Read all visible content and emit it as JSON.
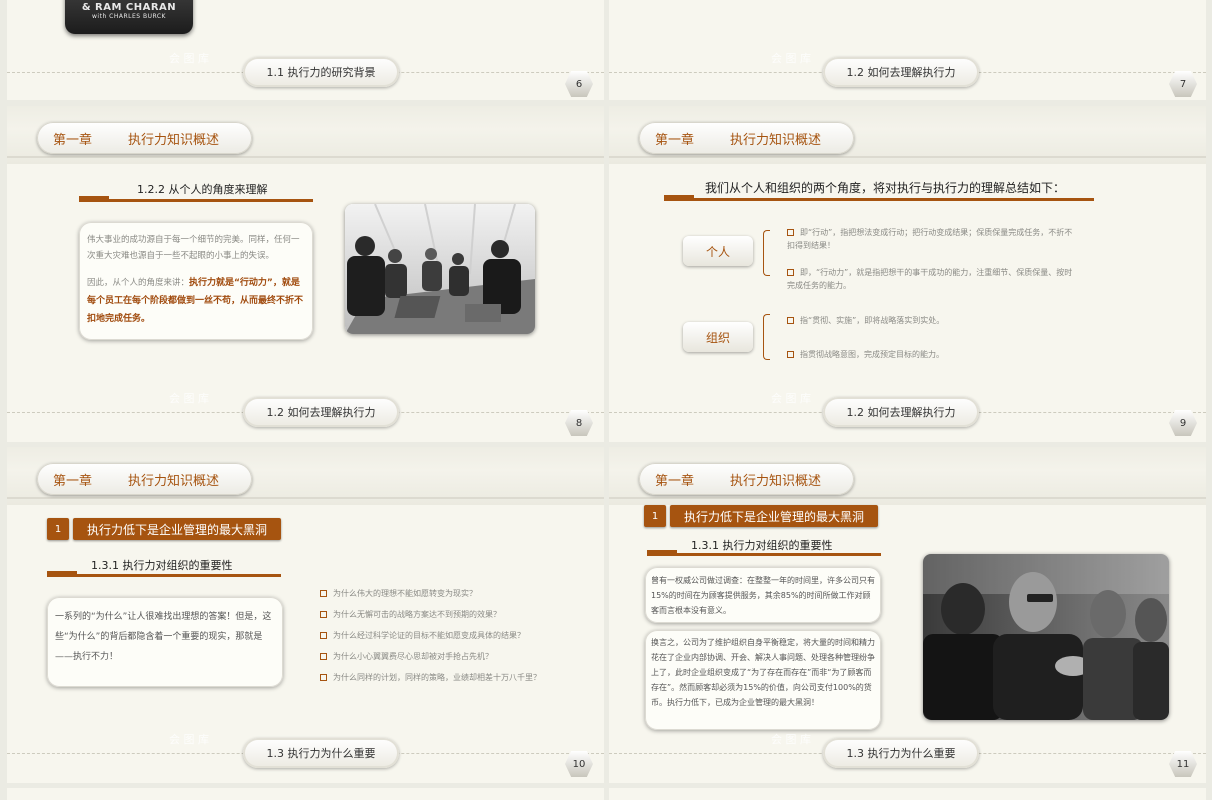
{
  "chapter": {
    "label": "第一章",
    "title": "执行力知识概述"
  },
  "watermark": "会 图 库",
  "slides": [
    {
      "footer": "1.1 执行力的研究背景",
      "page": "6",
      "book": {
        "line1": "& RAM CHARAN",
        "line2": "with CHARLES BURCK"
      }
    },
    {
      "footer": "1.2 如何去理解执行力",
      "page": "7"
    },
    {
      "footer": "1.2 如何去理解执行力",
      "page": "8",
      "heading": "1.2.2 从个人的角度来理解",
      "para1": "伟大事业的成功源自于每一个细节的完美。同样，任何一次重大灾难也源自于一些不起眼的小事上的失误。",
      "para2_prefix": "因此，从个人的角度来讲：",
      "para2_strong": "执行力就是“行动力”，就是每个员工在每个阶段都做到一丝不苟，从而最终不折不扣地完成任务。"
    },
    {
      "footer": "1.2 如何去理解执行力",
      "page": "9",
      "heading": "我们从个人和组织的两个角度，将对执行与执行力的理解总结如下：",
      "personal": {
        "label": "个人",
        "items": [
          "即“行动”，指把想法变成行动；把行动变成结果；保质保量完成任务，不折不扣得到结果！",
          "即，“行动力”，就是指把想干的事干成功的能力，注重细节、保质保量、按时完成任务的能力。"
        ]
      },
      "organization": {
        "label": "组织",
        "items": [
          "指“贯彻、实施”，即将战略落实到实处。",
          "指贯彻战略意图，完成预定目标的能力。"
        ]
      }
    },
    {
      "footer": "1.3 执行力为什么重要",
      "page": "10",
      "num": "1",
      "title": "执行力低下是企业管理的最大黑洞",
      "heading": "1.3.1 执行力对组织的重要性",
      "card": "一系列的“为什么”让人很难找出理想的答案！但是，这些“为什么”的背后都隐含着一个重要的现实，那就是——执行不力！",
      "questions": [
        "为什么伟大的理想不能如愿转变为现实？",
        "为什么无懈可击的战略方案达不到预期的效果？",
        "为什么经过科学论证的目标不能如愿变成具体的结果？",
        "为什么小心翼翼费尽心思却被对手抢占先机？",
        "为什么同样的计划，同样的策略，业绩却相差十万八千里？"
      ]
    },
    {
      "footer": "1.3 执行力为什么重要",
      "page": "11",
      "num": "1",
      "title": "执行力低下是企业管理的最大黑洞",
      "heading": "1.3.1 执行力对组织的重要性",
      "card1": "曾有一权威公司做过调查：在整整一年的时间里，许多公司只有15%的时间在为顾客提供服务，其余85%的时间所做工作对顾客而言根本没有意义。",
      "card2": "换言之，公司为了维护组织自身平衡稳定，将大量的时间和精力花在了企业内部协调、开会、解决人事问题、处理各种管理纷争上了，此时企业组织变成了“为了存在而存在”而非“为了顾客而存在”。然而顾客却必须为15%的价值，向公司支付100%的货币。执行力低下，已成为企业管理的最大黑洞！"
    }
  ]
}
